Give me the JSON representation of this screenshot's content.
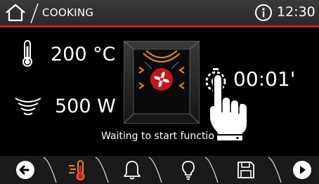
{
  "header": {
    "title": "COOKING",
    "clock": "12:30",
    "home_icon": "home-icon",
    "info_icon": "info-icon"
  },
  "main": {
    "temperature": "200 °C",
    "power": "500 W",
    "timer": "00:01'",
    "status": "Waiting to start functio",
    "temperature_icon": "thermometer-icon",
    "power_icon": "microwave-waves-icon",
    "timer_icon": "timer-icon",
    "oven_icon": "oven-fan-grill-icon"
  },
  "bottom_bar": {
    "items": [
      {
        "icon": "back-arrow-icon"
      },
      {
        "icon": "heat-thermometer-icon",
        "active": true
      },
      {
        "icon": "bell-icon"
      },
      {
        "icon": "lightbulb-icon"
      },
      {
        "icon": "save-icon"
      },
      {
        "icon": "play-icon"
      }
    ]
  },
  "colors": {
    "accent_red": "#d32027",
    "active_orange": "#e8882a",
    "background": "#000000",
    "header_bg": "#333333"
  }
}
